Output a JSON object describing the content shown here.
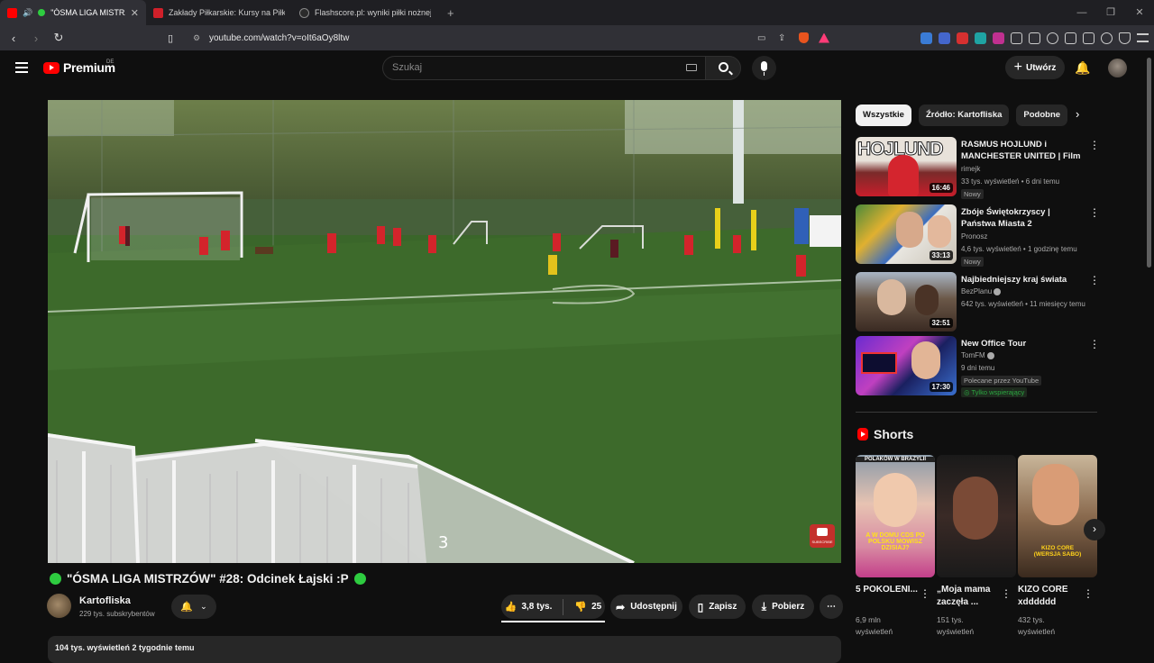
{
  "browser": {
    "tabs": [
      {
        "title": "\"ÓSMA LIGA MISTRZÓW\"",
        "active": true
      },
      {
        "title": "Zakłady Piłkarskie: Kursy na Piłkę No..",
        "active": false
      },
      {
        "title": "Flashscore.pl: wyniki piłki nożnej, wy..",
        "active": false
      }
    ],
    "url": "youtube.com/watch?v=oIt6aOy8ltw"
  },
  "header": {
    "logo_text": "Premium",
    "logo_country": "DE",
    "search_placeholder": "Szukaj",
    "create_label": "Utwórz"
  },
  "video": {
    "overlay_number": "3",
    "subscribe_badge": "SUBSCRIBE",
    "title": "\"ÓSMA LIGA MISTRZÓW\" #28: Odcinek Łajski :P",
    "channel": {
      "name": "Kartofliska",
      "subs": "229 tys. subskrybentów"
    },
    "likes": "3,8 tys.",
    "dislikes": "25",
    "share_label": "Udostępnij",
    "save_label": "Zapisz",
    "download_label": "Pobierz",
    "description_meta": "104 tys. wyświetleń  2 tygodnie temu"
  },
  "chips": [
    "Wszystkie",
    "Źródło: Kartofliska",
    "Podobne"
  ],
  "recommendations": [
    {
      "title": "RASMUS HOJLUND i MANCHESTER UNITED | Film ...",
      "channel": "rimejk",
      "meta": "33 tys. wyświetleń • 6 dni temu",
      "badge": "Nowy",
      "duration": "16:46",
      "thumb_text": "HOJLUND"
    },
    {
      "title": "Zbóje Świętokrzyscy | Państwa Miasta 2",
      "channel": "Pronosz",
      "meta": "4,6 tys. wyświetleń • 1 godzinę temu",
      "badge": "Nowy",
      "duration": "33:13"
    },
    {
      "title": "Najbiedniejszy kraj świata",
      "channel": "BezPlanu",
      "meta": "642 tys. wyświetleń • 11 miesięcy temu",
      "duration": "32:51"
    },
    {
      "title": "New Office Tour",
      "channel": "TomFM",
      "meta": "9 dni temu",
      "badge": "Polecane przez YouTube",
      "members": "Tylko wspierający",
      "duration": "17:30"
    }
  ],
  "shorts": {
    "heading": "Shorts",
    "items": [
      {
        "title": "5 POKOLENI...",
        "views": "6,9 mln wyświetleń",
        "caption_top": "POLAKÓW W BRAZYLII",
        "caption_mid": "A W DOMU CDS PO POLSKU MOWISZ DZISIAJ?"
      },
      {
        "title": "„Moja mama zaczęła ...",
        "views": "151 tys. wyświetleń"
      },
      {
        "title": "KIZO CORE xdddddd",
        "views": "432 tys. wyświetleń",
        "caption_mid": "KIZO CORE (WERSJA SABO)"
      }
    ]
  },
  "colors": {
    "brand": "#ff0000",
    "background": "#0f0f0f",
    "accent_green": "#2ecc40"
  }
}
